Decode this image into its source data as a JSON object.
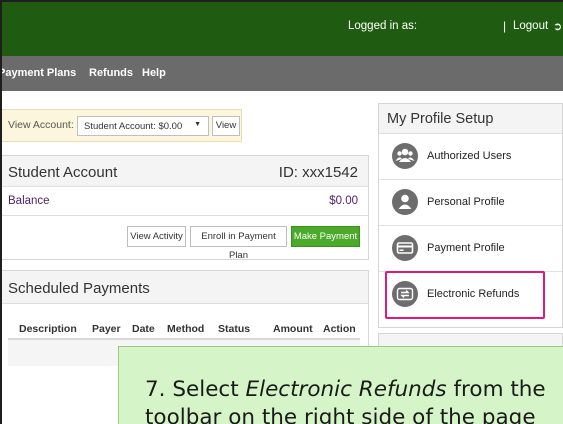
{
  "header": {
    "logged_in_label": "Logged in as:",
    "separator": "|",
    "logout_label": "Logout",
    "logout_icon": "sign-out-icon",
    "bg_color": "#1f5c12"
  },
  "nav": {
    "items": [
      {
        "label": "Payment Plans"
      },
      {
        "label": "Refunds"
      },
      {
        "label": "Help"
      }
    ],
    "bg_color": "#6b6b6b"
  },
  "view_account": {
    "label": "View Account:",
    "selected_value": "Student Account: $0.00",
    "view_button": "View"
  },
  "student_account": {
    "title": "Student Account",
    "id_label": "ID: xxx1542",
    "balance_label": "Balance",
    "balance_value": "$0.00",
    "buttons": {
      "view_activity": "View Activity",
      "enroll": "Enroll in Payment Plan",
      "make_payment": "Make Payment"
    },
    "make_payment_color": "#4caa2b"
  },
  "scheduled_payments": {
    "title": "Scheduled Payments",
    "columns": [
      "Description",
      "Payer",
      "Date",
      "Method",
      "Status",
      "Amount",
      "Action"
    ]
  },
  "profile_setup": {
    "title": "My Profile Setup",
    "items": [
      {
        "label": "Authorized Users",
        "icon": "users-icon"
      },
      {
        "label": "Personal Profile",
        "icon": "user-icon"
      },
      {
        "label": "Payment Profile",
        "icon": "credit-card-icon"
      },
      {
        "label": "Electronic Refunds",
        "icon": "exchange-icon"
      }
    ],
    "highlight_color": "#e0197d"
  },
  "callout": {
    "line1_prefix": "7. Select ",
    "line1_emph": "Electronic Refunds",
    "line1_suffix": " from the",
    "line2": "toolbar on the right side of the page",
    "bg_color": "#d5f5c8"
  }
}
